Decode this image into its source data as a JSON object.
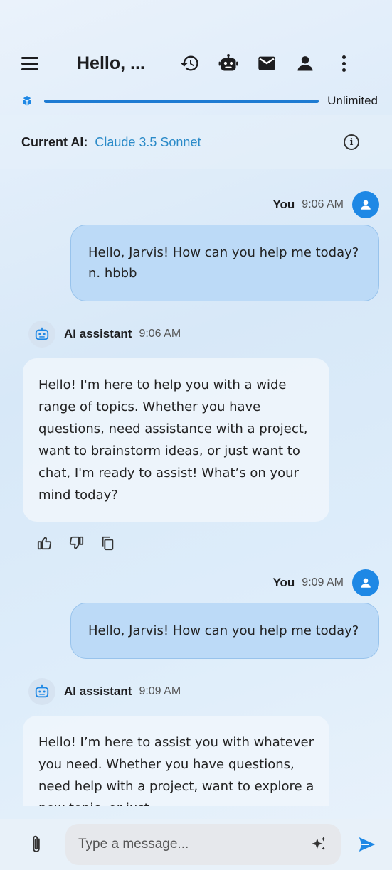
{
  "header": {
    "title": "Hello, ...",
    "icons": [
      "menu-icon",
      "history-icon",
      "bot-icon",
      "mail-icon",
      "person-icon",
      "more-vert-icon"
    ]
  },
  "usage": {
    "label": "Unlimited",
    "progress": 1.0
  },
  "current_ai": {
    "label": "Current AI:",
    "model": "Claude 3.5 Sonnet"
  },
  "messages": [
    {
      "role": "user",
      "sender": "You",
      "time": "9:06 AM",
      "text": "Hello, Jarvis! How can you help me today?n.  hbbb"
    },
    {
      "role": "ai",
      "sender": "AI assistant",
      "time": "9:06 AM",
      "text": "Hello! I'm here to help you with a wide range of topics. Whether you have questions, need assistance with a project, want to brainstorm ideas, or just want to chat, I'm ready to assist! What’s on your mind today?"
    },
    {
      "role": "user",
      "sender": "You",
      "time": "9:09 AM",
      "text": "Hello, Jarvis! How can you help me today?"
    },
    {
      "role": "ai",
      "sender": "AI assistant",
      "time": "9:09 AM",
      "text": "Hello! I’m here to assist you with whatever you need. Whether you have questions, need help with a project, want to explore a new topic, or just"
    }
  ],
  "composer": {
    "placeholder": "Type a message..."
  },
  "colors": {
    "accent": "#1e88e5",
    "model_text": "#2a8ac8",
    "user_bubble": "#bcdaf7"
  }
}
